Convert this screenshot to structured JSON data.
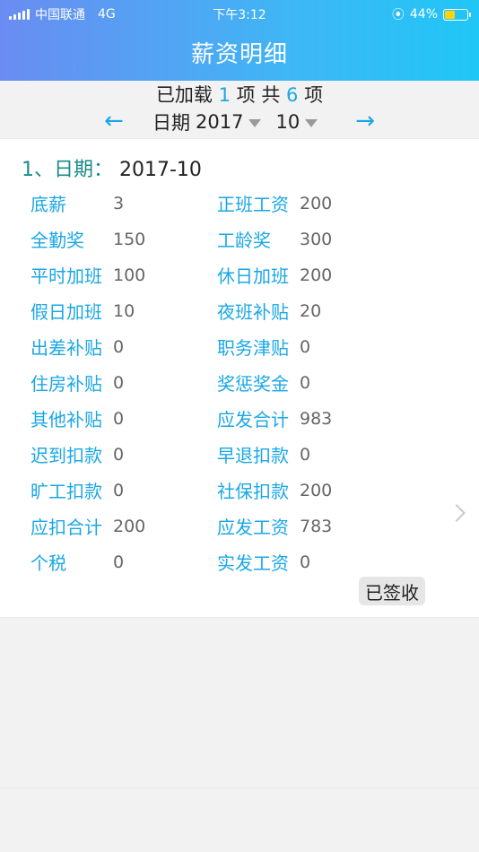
{
  "status_bar": {
    "carrier": "中国联通",
    "network": "4G",
    "time": "下午3:12",
    "battery_percent_text": "44%",
    "battery_fraction": 0.44
  },
  "header": {
    "title": "薪资明细"
  },
  "load_info": {
    "prefix": "已加载",
    "loaded": "1",
    "middle": "项 共",
    "total": "6",
    "suffix": "项"
  },
  "date_selector": {
    "label": "日期",
    "year": "2017",
    "month": "10",
    "left_arrow": "←",
    "right_arrow": "→"
  },
  "record": {
    "title_prefix": "1、日期：",
    "date": "2017-10",
    "items": [
      {
        "left_label": "底薪",
        "left_value": "3",
        "right_label": "正班工资",
        "right_value": "200"
      },
      {
        "left_label": "全勤奖",
        "left_value": "150",
        "right_label": "工龄奖",
        "right_value": "300"
      },
      {
        "left_label": "平时加班",
        "left_value": "100",
        "right_label": "休日加班",
        "right_value": "200"
      },
      {
        "left_label": "假日加班",
        "left_value": "10",
        "right_label": "夜班补贴",
        "right_value": "20"
      },
      {
        "left_label": "出差补贴",
        "left_value": "0",
        "right_label": "职务津贴",
        "right_value": "0"
      },
      {
        "left_label": "住房补贴",
        "left_value": "0",
        "right_label": "奖惩奖金",
        "right_value": "0"
      },
      {
        "left_label": "其他补贴",
        "left_value": "0",
        "right_label": "应发合计",
        "right_value": "983"
      },
      {
        "left_label": "迟到扣款",
        "left_value": "0",
        "right_label": "早退扣款",
        "right_value": "0"
      },
      {
        "left_label": "旷工扣款",
        "left_value": "0",
        "right_label": "社保扣款",
        "right_value": "200"
      },
      {
        "left_label": "应扣合计",
        "left_value": "200",
        "right_label": "应发工资",
        "right_value": "783"
      },
      {
        "left_label": "个税",
        "left_value": "0",
        "right_label": "实发工资",
        "right_value": "0"
      }
    ],
    "signed_button": "已签收"
  },
  "colors": {
    "accent": "#1aa7e6",
    "title_teal": "#1a8a8a",
    "header_gradient_start": "#6a8cf2",
    "header_gradient_end": "#1fc6f6"
  }
}
